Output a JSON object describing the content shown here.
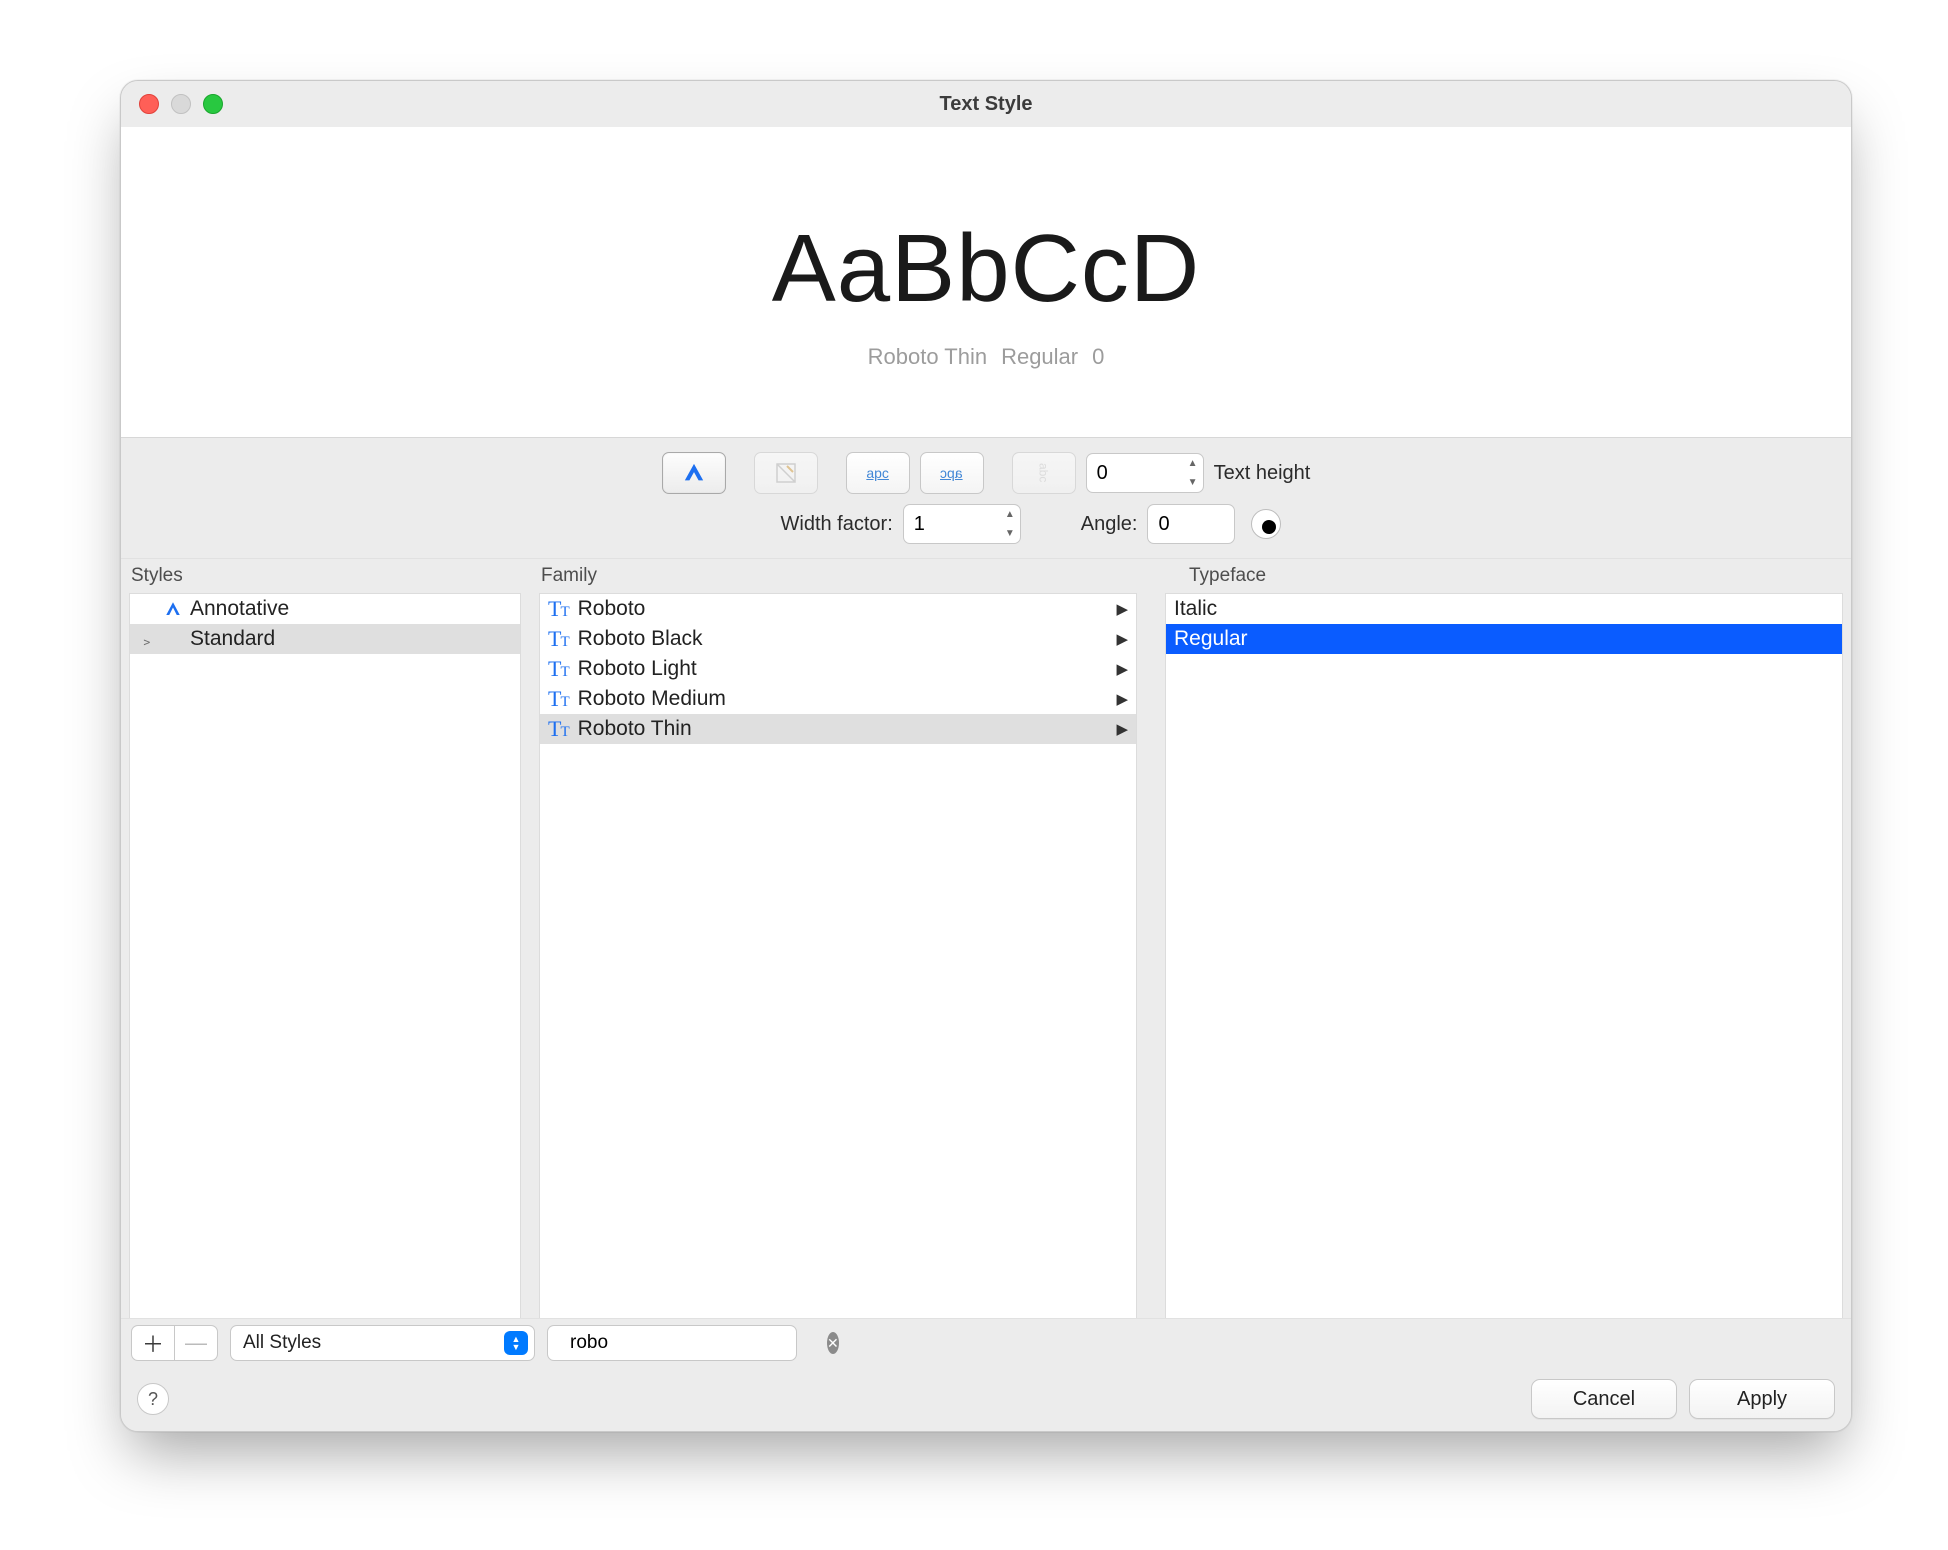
{
  "window": {
    "title": "Text Style"
  },
  "preview": {
    "sample": "AaBbCcD",
    "font_name": "Roboto Thin",
    "typeface": "Regular",
    "height": "0"
  },
  "toolbar": {
    "text_height": {
      "value": "0",
      "label": "Text height"
    },
    "width_factor": {
      "label": "Width factor:",
      "value": "1"
    },
    "angle": {
      "label": "Angle:",
      "value": "0"
    }
  },
  "columns": {
    "styles_header": "Styles",
    "family_header": "Family",
    "typeface_header": "Typeface"
  },
  "styles": {
    "items": [
      {
        "label": "Annotative",
        "annotative": true,
        "selected": false,
        "expandable": false
      },
      {
        "label": "Standard",
        "annotative": false,
        "selected": true,
        "expandable": true
      }
    ]
  },
  "families": {
    "items": [
      {
        "label": "Roboto",
        "selected": false
      },
      {
        "label": "Roboto Black",
        "selected": false
      },
      {
        "label": "Roboto Light",
        "selected": false
      },
      {
        "label": "Roboto Medium",
        "selected": false
      },
      {
        "label": "Roboto Thin",
        "selected": true
      }
    ]
  },
  "typefaces": {
    "items": [
      {
        "label": "Italic",
        "selected": false
      },
      {
        "label": "Regular",
        "selected": true
      }
    ]
  },
  "bottombar": {
    "filter_label": "All Styles",
    "search_value": "robo"
  },
  "footer": {
    "cancel": "Cancel",
    "apply": "Apply"
  }
}
